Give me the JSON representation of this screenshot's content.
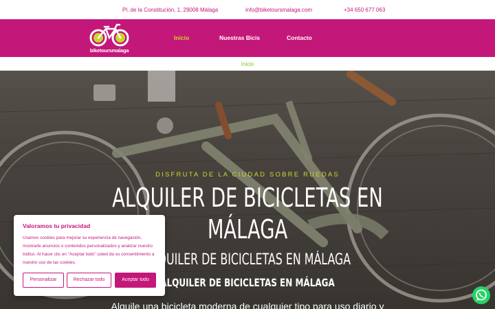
{
  "topbar": {
    "address": "Pl. de la Constitución, 1, 29008 Málaga",
    "email": "info@biketoursmalaga.com",
    "phone": "+34 650 677 063"
  },
  "brand": {
    "logo_text": "biketoursmalaga"
  },
  "nav": {
    "items": [
      {
        "label": "Inicio",
        "active": true
      },
      {
        "label": "Nuestras Bicis",
        "active": false
      },
      {
        "label": "Contacto",
        "active": false
      }
    ]
  },
  "breadcrumb": {
    "current": "Inicio"
  },
  "hero": {
    "kicker": "DISFRUTA DE LA CIUDAD SOBRE RUEDAS",
    "title": "ALQUILER DE BICICLETAS EN MÁLAGA",
    "subtitle": "ALQUILER DE BICICLETAS EN MÁLAGA",
    "subtitle_small": "ALQUILER DE BICICLETAS EN MÁLAGA",
    "lead": "Alquile una bicicleta moderna de cualquier tipo para uso diario y"
  },
  "cookie_banner": {
    "title": "Valoramos tu privacidad",
    "body": "Usamos cookies para mejorar su experiencia de navegación, mostrarle anuncios o contenidos personalizados y analizar nuestro tráfico. Al hacer clic en \"Aceptar todo\" usted da su consentimiento a nuestro uso de las cookies.",
    "customize_label": "Personalizar",
    "reject_label": "Rechazar todo",
    "accept_label": "Aceptar todo"
  },
  "colors": {
    "brand_magenta": "#c4177a",
    "accent_lime": "#c9d92b",
    "breadcrumb_green": "#8cbf1e",
    "whatsapp_green": "#25d366"
  },
  "icons": {
    "whatsapp": "whatsapp-icon",
    "logo": "bicycle-logo-icon"
  }
}
